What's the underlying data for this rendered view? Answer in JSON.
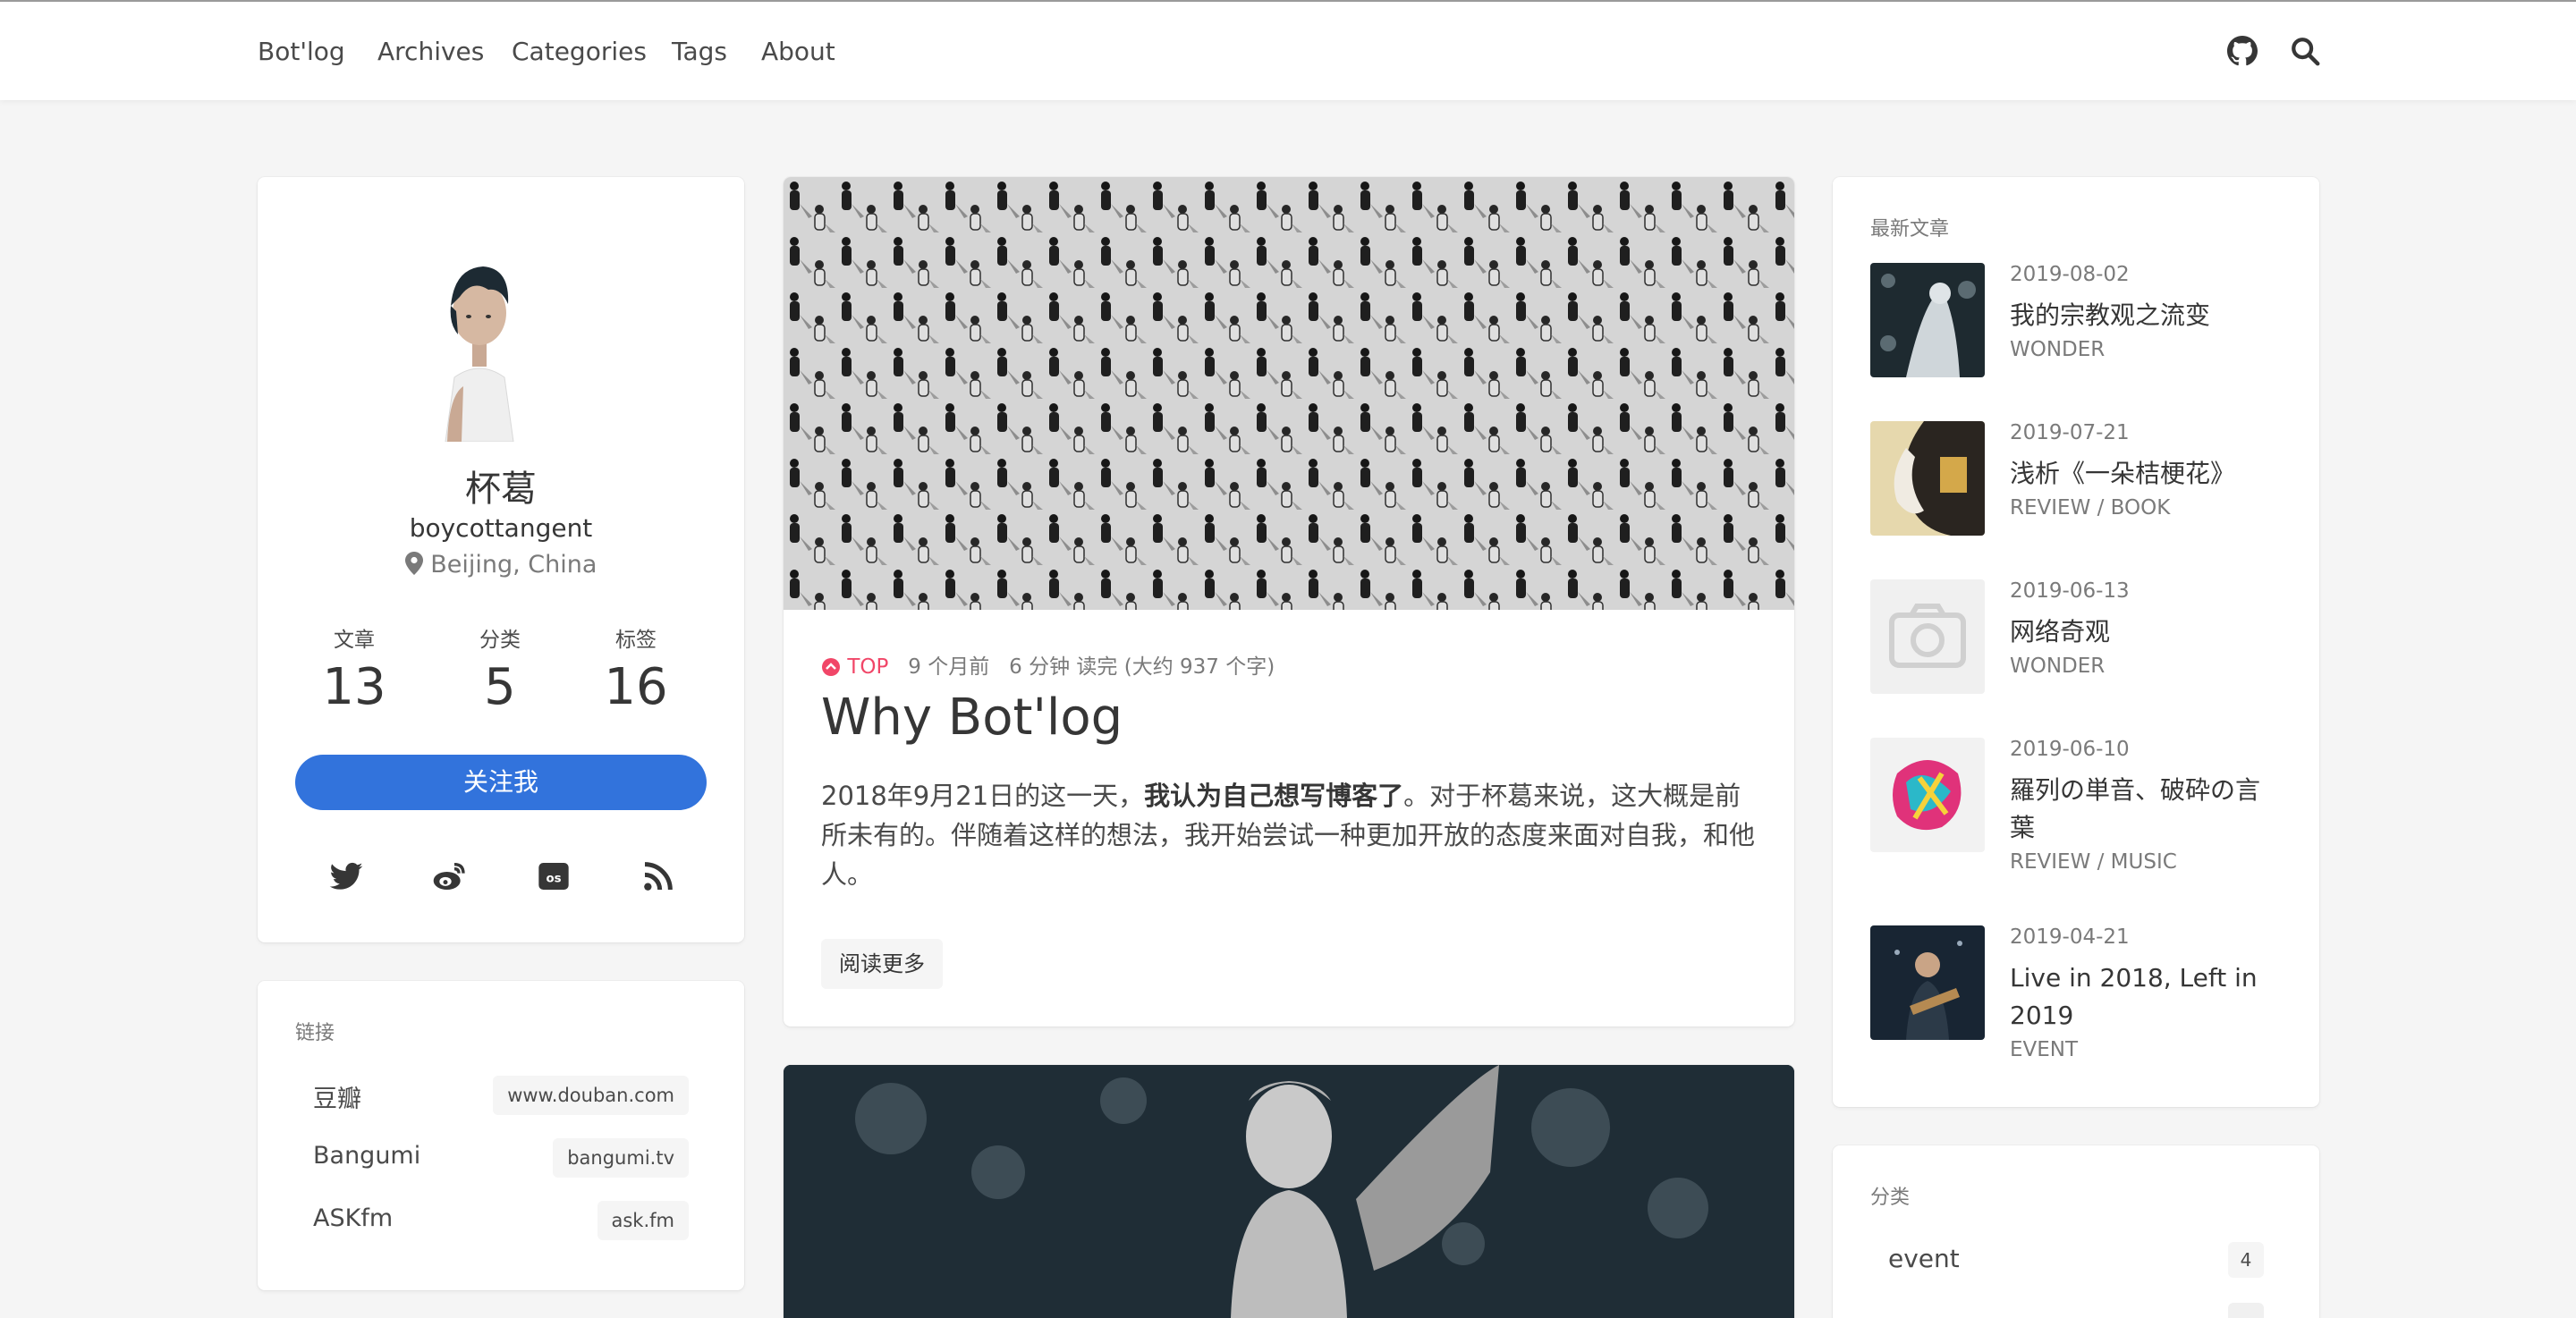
{
  "nav": {
    "brand": "Bot'log",
    "items": [
      "Archives",
      "Categories",
      "Tags",
      "About"
    ],
    "github_icon": "github-icon",
    "search_icon": "search-icon"
  },
  "profile": {
    "name": "杯葛",
    "handle": "boycottangent",
    "location": "Beijing, China",
    "stats": [
      {
        "label": "文章",
        "value": "13"
      },
      {
        "label": "分类",
        "value": "5"
      },
      {
        "label": "标签",
        "value": "16"
      }
    ],
    "follow_label": "关注我",
    "socials": [
      "twitter-icon",
      "weibo-icon",
      "lastfm-icon",
      "rss-icon"
    ]
  },
  "links": {
    "title": "链接",
    "items": [
      {
        "name": "豆瓣",
        "url": "www.douban.com"
      },
      {
        "name": "Bangumi",
        "url": "bangumi.tv"
      },
      {
        "name": "ASKfm",
        "url": "ask.fm"
      }
    ]
  },
  "article": {
    "badge": "TOP",
    "time_ago": "9 个月前",
    "read_time": "6 分钟 读完 (大约 937 个字)",
    "title": "Why Bot'log",
    "excerpt_1": "2018年9月21日的这一天，",
    "excerpt_bold": "我认为自己想写博客了",
    "excerpt_2": "。对于杯葛来说，这大概是前所未有的。伴随着这样的想法，我开始尝试一种更加开放的态度来面对自我，和他人。",
    "read_more": "阅读更多"
  },
  "recent": {
    "title": "最新文章",
    "items": [
      {
        "date": "2019-08-02",
        "title": "我的宗教观之流变",
        "cats": "WONDER"
      },
      {
        "date": "2019-07-21",
        "title": "浅析《一朵桔梗花》",
        "cats": "REVIEW / BOOK"
      },
      {
        "date": "2019-06-13",
        "title": "网络奇观",
        "cats": "WONDER"
      },
      {
        "date": "2019-06-10",
        "title": "羅列の単音、破砕の言葉",
        "cats": "REVIEW / MUSIC"
      },
      {
        "date": "2019-04-21",
        "title": "Live in 2018, Left in 2019",
        "cats": "EVENT"
      }
    ]
  },
  "categories": {
    "title": "分类",
    "items": [
      {
        "name": "event",
        "count": "4"
      }
    ]
  },
  "colors": {
    "accent": "#3273dc",
    "top_badge": "#f14668",
    "background": "#f5f5f5"
  }
}
